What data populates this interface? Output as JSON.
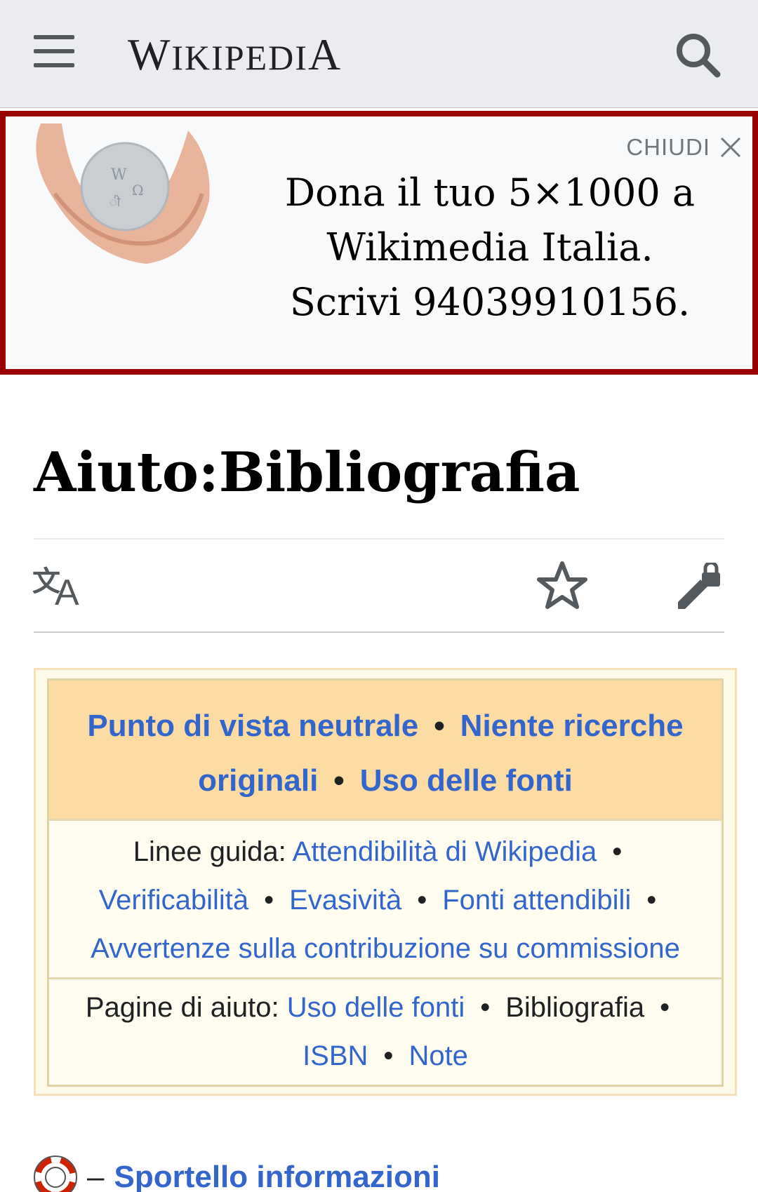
{
  "header": {
    "menu_icon": "hamburger-menu-icon",
    "wordmark_first": "W",
    "wordmark_middle": "IKIPEDI",
    "wordmark_last": "A",
    "search_icon": "search-icon"
  },
  "banner": {
    "close_label": "CHIUDI",
    "close_icon": "close-icon",
    "image_icon": "hands-holding-globe-image",
    "line1": "Dona il tuo 5×1000 a",
    "line2": "Wikimedia Italia.",
    "line3": "Scrivi 94039910156.",
    "border_color": "#990000"
  },
  "page": {
    "title": "Aiuto:Bibliografia"
  },
  "toolbar": {
    "language_icon": "language-icon",
    "watch_icon": "star-icon",
    "edit_icon": "edit-locked-icon"
  },
  "navbox": {
    "head": {
      "link1": "Punto di vista neutrale",
      "link2": "Niente ricerche originali",
      "link3": "Uso delle fonti"
    },
    "guidelines": {
      "label": "Linee guida:",
      "links": [
        "Attendibilità di Wikipedia",
        "Verificabilità",
        "Evasività",
        "Fonti attendibili",
        "Avvertenze sulla contribuzione su commissione"
      ]
    },
    "help_pages": {
      "label": "Pagine di aiuto:",
      "link1": "Uso delle fonti",
      "current": "Bibliografia",
      "link2": "ISBN",
      "link3": "Note"
    },
    "separator": "•"
  },
  "footer_link": {
    "icon": "lifebuoy-icon",
    "dash": "–",
    "label": "Sportello informazioni"
  },
  "colors": {
    "link": "#3366cc",
    "navbox_head": "#fcdca3",
    "navbox_body": "#fffdf0"
  }
}
